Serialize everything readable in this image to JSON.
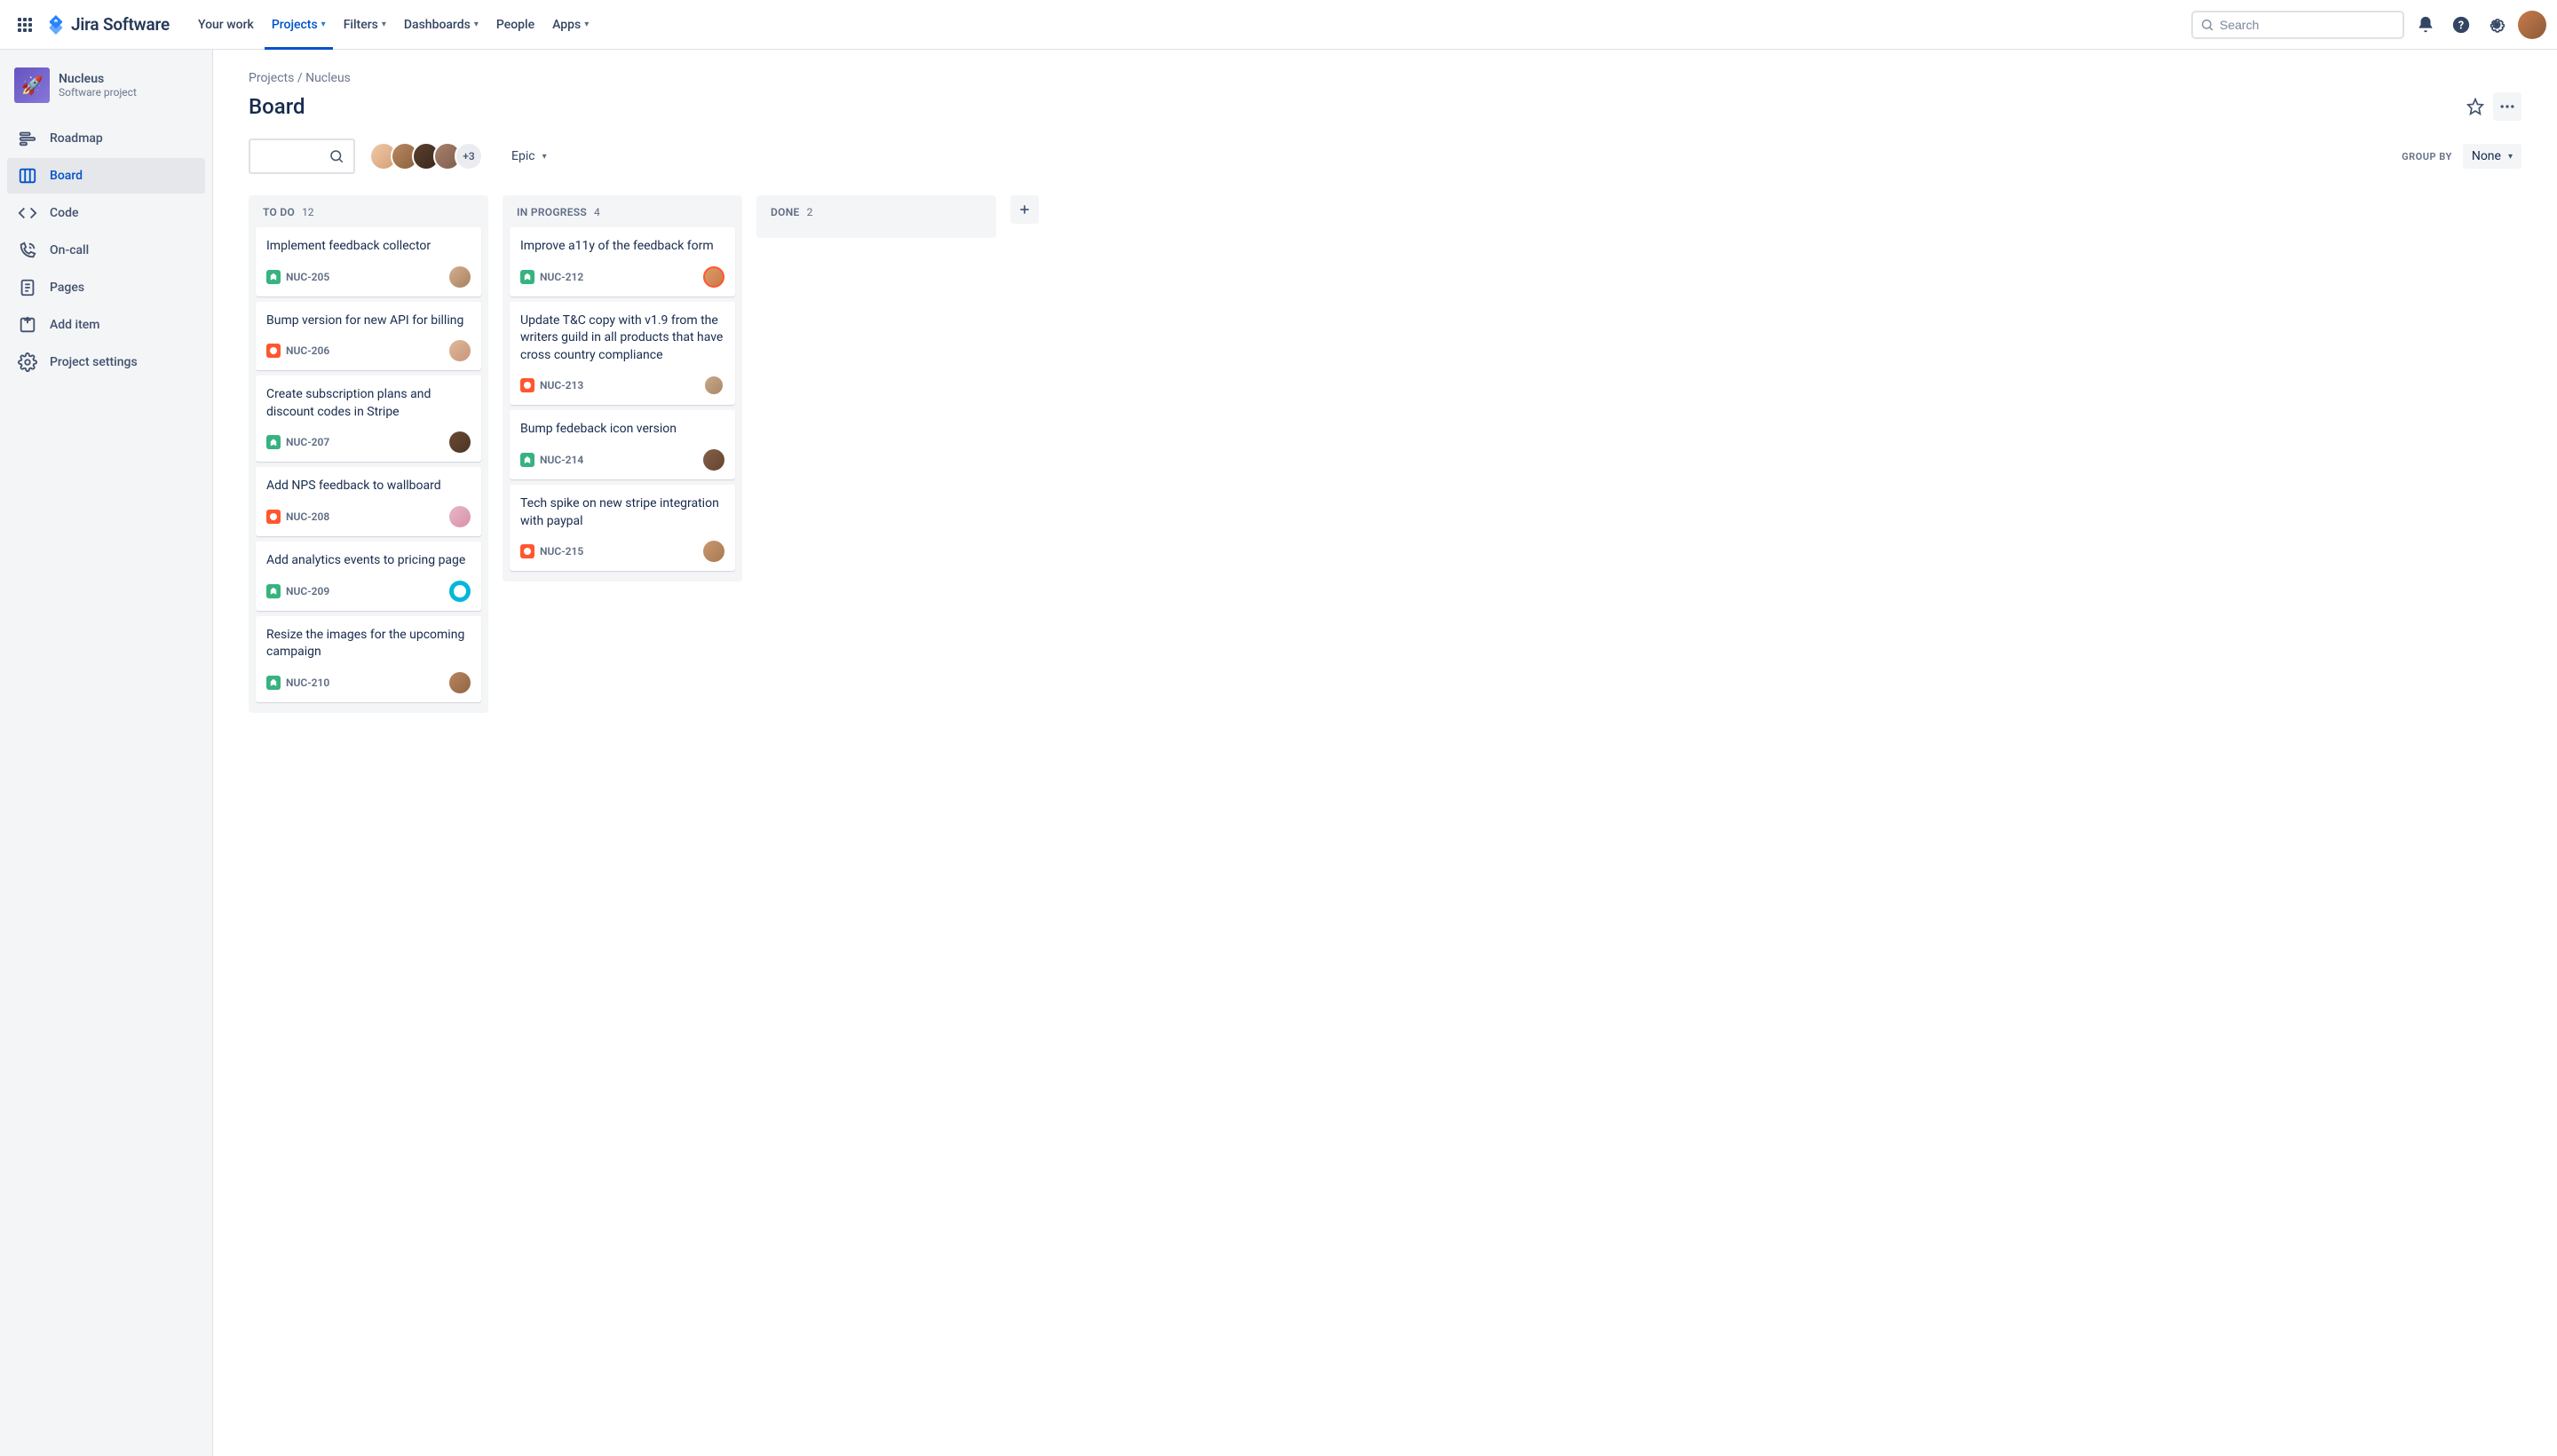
{
  "nav": {
    "logo_text": "Jira Software",
    "your_work": "Your work",
    "projects": "Projects",
    "filters": "Filters",
    "dashboards": "Dashboards",
    "people": "People",
    "apps": "Apps",
    "search_placeholder": "Search"
  },
  "sidebar": {
    "project_name": "Nucleus",
    "project_type": "Software project",
    "items": {
      "roadmap": "Roadmap",
      "board": "Board",
      "code": "Code",
      "oncall": "On-call",
      "pages": "Pages",
      "add_item": "Add item",
      "settings": "Project settings"
    }
  },
  "breadcrumb": {
    "projects": "Projects",
    "sep": "/",
    "current": "Nucleus"
  },
  "page": {
    "title": "Board"
  },
  "toolbar": {
    "avatar_more": "+3",
    "epic": "Epic",
    "group_by_label": "GROUP BY",
    "group_by_value": "None"
  },
  "columns": [
    {
      "title": "TO DO",
      "count": "12"
    },
    {
      "title": "IN PROGRESS",
      "count": "4"
    },
    {
      "title": "DONE",
      "count": "2"
    }
  ],
  "cards_todo": [
    {
      "title": "Implement feedback collector",
      "key": "NUC-205",
      "type": "story",
      "avatar": "ca1"
    },
    {
      "title": "Bump version for new API for billing",
      "key": "NUC-206",
      "type": "bug",
      "avatar": "ca2"
    },
    {
      "title": "Create subscription plans and discount codes in Stripe",
      "key": "NUC-207",
      "type": "story",
      "avatar": "ca3"
    },
    {
      "title": "Add NPS feedback to wallboard",
      "key": "NUC-208",
      "type": "bug",
      "avatar": "ca4"
    },
    {
      "title": "Add analytics events to pricing page",
      "key": "NUC-209",
      "type": "story",
      "avatar": "ca5"
    },
    {
      "title": "Resize the images for the upcoming campaign",
      "key": "NUC-210",
      "type": "story",
      "avatar": "ca6"
    }
  ],
  "cards_inprogress": [
    {
      "title": "Improve a11y of the feedback form",
      "key": "NUC-212",
      "type": "story",
      "avatar": "ca7"
    },
    {
      "title": "Update T&C copy with v1.9 from the writers guild in all products that have cross country compliance",
      "key": "NUC-213",
      "type": "bug",
      "avatar": "ca8"
    },
    {
      "title": "Bump fedeback icon version",
      "key": "NUC-214",
      "type": "story",
      "avatar": "ca9"
    },
    {
      "title": "Tech spike on new stripe integration with paypal",
      "key": "NUC-215",
      "type": "bug",
      "avatar": "ca10"
    }
  ]
}
